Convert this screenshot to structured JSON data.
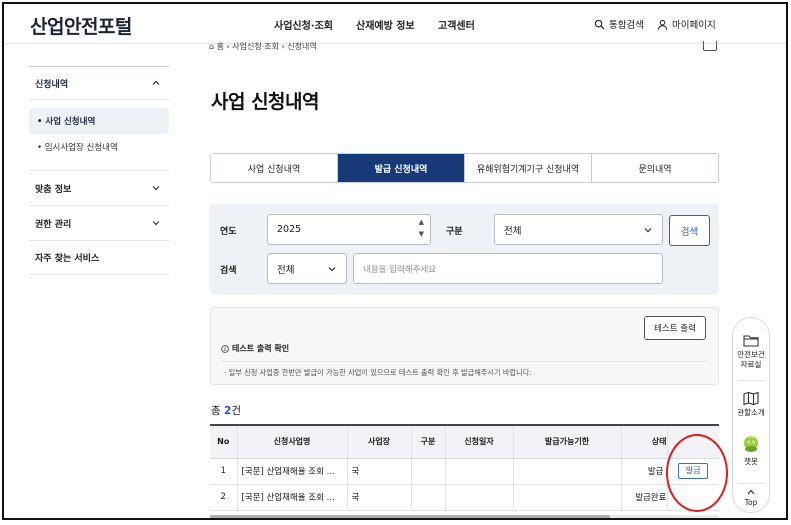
{
  "header": {
    "logo": "산업안전포털",
    "nav": [
      "사업신청·조회",
      "산재예방 정보",
      "고객센터"
    ],
    "util": {
      "search": "통합검색",
      "mypage": "마이페이지"
    }
  },
  "breadcrumb": [
    "홈",
    "사업신청·조회",
    "신청내역"
  ],
  "sidebar": {
    "section": "신청내역",
    "subitems": [
      {
        "label": "• 사업 신청내역",
        "active": true
      },
      {
        "label": "• 임시사업장 신청내역",
        "active": false
      }
    ],
    "items": [
      "맞춤 정보",
      "권한 관리",
      "자주 찾는 서비스"
    ]
  },
  "page_title": "사업 신청내역",
  "tabs": [
    {
      "label": "사업 신청내역",
      "active": false
    },
    {
      "label": "발급 신청내역",
      "active": true
    },
    {
      "label": "유해위험기계기구 신청내역",
      "active": false
    },
    {
      "label": "문의내역",
      "active": false
    }
  ],
  "search": {
    "year_label": "연도",
    "year_value": "2025",
    "type_label": "구분",
    "type_value": "전체",
    "button": "검색",
    "keyword_label": "검색",
    "keyword_type": "전체",
    "keyword_placeholder": "내용을 입력해주세요"
  },
  "notice": {
    "print_button": "테스트 출력",
    "title": "테스트 출력 확인",
    "text": "· 일부 신청 사업중 한번만 발급이 가능한 사업이 있으므로 테스트 출력 확인 후 발급해주시기 바랍니다."
  },
  "total": {
    "prefix": "총 ",
    "count": "2",
    "suffix": "건"
  },
  "table": {
    "headers": [
      "No",
      "신청사업명",
      "사업장",
      "구분",
      "신청일자",
      "발급가능기한",
      "상태"
    ],
    "rows": [
      {
        "no": "1",
        "name": "[국문] 산업재해율 조회 ...",
        "site": "국",
        "status": "발급",
        "action": "발급"
      },
      {
        "no": "2",
        "name": "[국문] 산업재해율 조회 ...",
        "site": "국",
        "status": "발급완료",
        "action": ""
      }
    ]
  },
  "quick_menu": {
    "items": [
      "안전보건 자료실",
      "관할소개",
      "챗봇"
    ],
    "top": "Top"
  },
  "colors": {
    "accent": "#163a78",
    "link": "#2a63c6",
    "highlight": "#e21b1b"
  }
}
